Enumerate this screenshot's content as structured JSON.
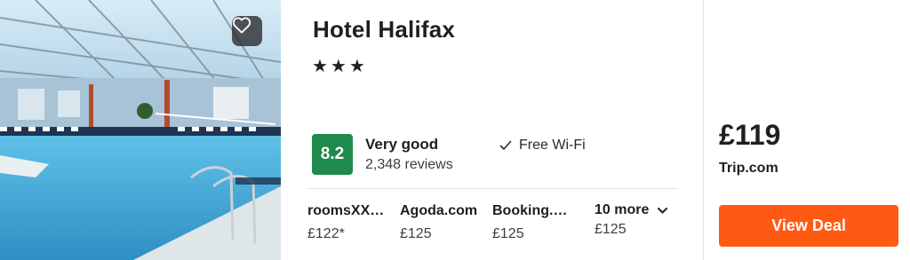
{
  "hotel": {
    "name": "Hotel Halifax",
    "stars": "★★★"
  },
  "rating": {
    "score": "8.2",
    "label": "Very good",
    "reviews": "2,348 reviews",
    "badge_color": "#1e8a4c"
  },
  "amenities": [
    {
      "icon": "check-icon",
      "label": "Free Wi-Fi"
    }
  ],
  "offers": [
    {
      "provider": "roomsXX…",
      "price": "£122*"
    },
    {
      "provider": "Agoda.com",
      "price": "£125"
    },
    {
      "provider": "Booking.…",
      "price": "£125"
    }
  ],
  "more_offers": {
    "label": "10 more",
    "icon": "chevron-down-icon",
    "price": "£125"
  },
  "best_deal": {
    "price": "£119",
    "provider": "Trip.com",
    "button_label": "View Deal",
    "button_color": "#ff5a14"
  },
  "favorite": {
    "icon": "heart-icon"
  }
}
